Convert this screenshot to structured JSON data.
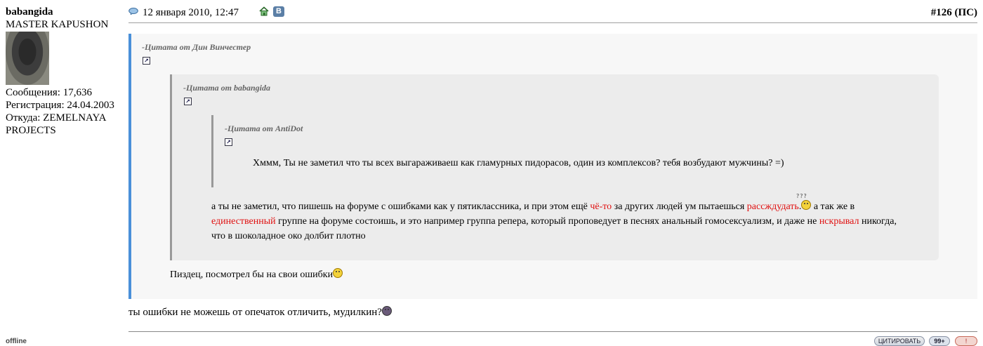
{
  "user": {
    "name": "babangida",
    "title": "MASTER KAPUSHON",
    "posts": "Сообщения: 17,636",
    "registered": "Регистрация: 24.04.2003",
    "from_line1": "Откуда: ZEMELNAYA",
    "from_line2": "PROJECTS",
    "status": "offline"
  },
  "post": {
    "date": "12 января 2010, 12:47",
    "vk_label": "В",
    "number": "#126",
    "ps": "(ПС)"
  },
  "quote1": {
    "header": "-Цитата от Дин Винчестер",
    "reply": "Пиздец, посмотрел бы на свои ошибки"
  },
  "quote2": {
    "header": "-Цитата от babangida",
    "line1": [
      "а ты не заметил, что пишешь на форуме с ошибками как у пятиклассника, и при этом ещё ",
      "чё-то",
      " за других людей ум пытаешься ",
      "рассждудать",
      ".",
      " а так же в"
    ],
    "line2": [
      "единественный",
      " группе на форуме состоишь, и это например группа репера, который проповедует в песнях анальный гомосексуализм, и даже не ",
      "нскрывал",
      " никогда,"
    ],
    "line3": "что в шоколадное око долбит плотно",
    "qmarks": "???"
  },
  "quote3": {
    "header": "-Цитата от AntiDot",
    "text": "Хммм, Ты не заметил что ты всех выгараживаеш как гламурных пидорасов, один из комплексов? тебя возбудают мужчины? =)"
  },
  "body_text": "ты ошибки не можешь от опечаток отличить, мудилкин?",
  "buttons": {
    "quote": "ЦИТИРОВАТЬ",
    "multiquote": "99+",
    "report": "!"
  },
  "colors": {
    "quote_bar": "#4a90d9",
    "error_highlight": "#e01010"
  }
}
